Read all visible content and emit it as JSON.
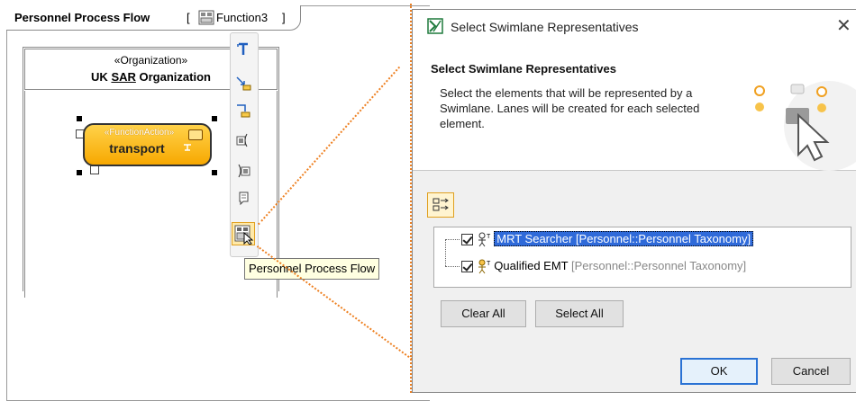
{
  "diagram": {
    "title": "Personnel Process Flow",
    "bracket_open": "[",
    "reference": "Function3",
    "bracket_close": "]",
    "lane": {
      "stereotype": "«Organization»",
      "name_prefix": "UK ",
      "name_underlined": "SAR",
      "name_suffix": " Organization"
    },
    "action": {
      "stereotype": "«FunctionAction»",
      "name": "transport"
    },
    "tooltip": "Personnel Process Flow",
    "smart_manipulator_icons": [
      "text-icon",
      "control-flow-icon",
      "object-flow-icon",
      "input-pin-icon",
      "output-pin-icon",
      "note-icon",
      "swimlane-representative-icon"
    ]
  },
  "dialog": {
    "title": "Select Swimlane Representatives",
    "close_glyph": "✕",
    "header_title": "Select Swimlane Representatives",
    "header_desc": "Select the elements that will be represented by a Swimlane. Lanes will be created for each selected element.",
    "tree": [
      {
        "name": "MRT Searcher",
        "qualifier": "[Personnel::Personnel Taxonomy]",
        "checked": true,
        "selected": true
      },
      {
        "name": "Qualified EMT",
        "qualifier": "[Personnel::Personnel Taxonomy]",
        "checked": true,
        "selected": false
      }
    ],
    "buttons": {
      "clear_all": "Clear All",
      "select_all": "Select All",
      "ok": "OK",
      "cancel": "Cancel"
    }
  },
  "colors": {
    "callout": "#ee8021",
    "action_fill": "#ffc20e",
    "selection": "#2f6ad9",
    "default_button": "#2a72d4",
    "dialog_icon": "#1e7a3c"
  }
}
